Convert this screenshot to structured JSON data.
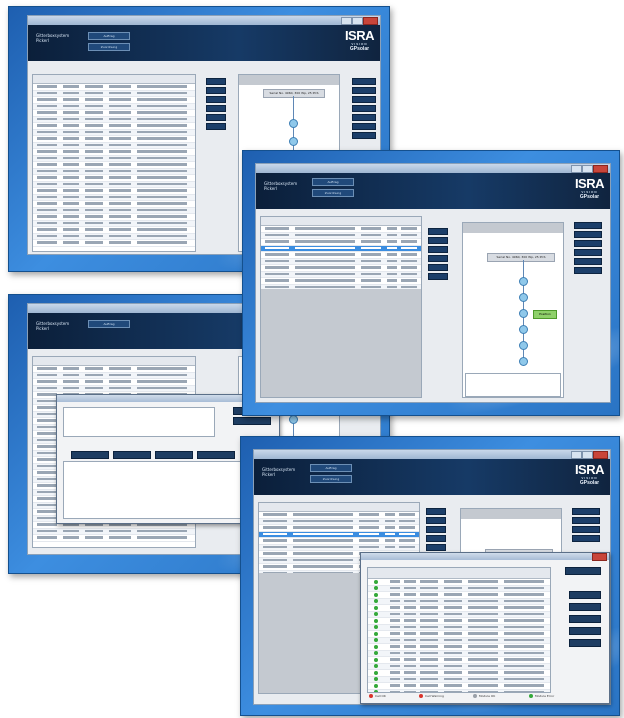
{
  "screens": [
    {
      "title_bar": "ISRA VISION GPsolar",
      "header_text": "Gitterboxsystem Pickerl"
    },
    {
      "title_bar": "ISRA VISION GPsolar",
      "header_text": "Gitterboxsystem Pickerl"
    },
    {
      "title_bar": "ISRA VISION GPsolar",
      "header_text": "Gitterboxsystem Pickerl"
    },
    {
      "title_bar": "ISRA VISION GPsolar",
      "header_text": "Gitterboxsystem Pickerl"
    }
  ],
  "logo": {
    "brand": "ISRA",
    "sub": "VISION",
    "product": "GPsolar"
  },
  "header_buttons": [
    "Auftrag",
    "Zuordnung"
  ],
  "tree_node_label": "Serial No. 4960, 300 Wp, 25 PCS",
  "green_node_label": "Position",
  "colors": {
    "desktop": "#2a78c8",
    "header": "#0b1f3a",
    "selection": "#3b8de0",
    "node": "#8fc8ea",
    "status_ok": "#34a93a"
  },
  "dialog_legend": [
    "Cell OK",
    "Cell Warning",
    "Module OK",
    "Module Error"
  ],
  "icons": [
    "window-close-icon",
    "window-maximize-icon",
    "window-minimize-icon",
    "status-dot-icon"
  ]
}
